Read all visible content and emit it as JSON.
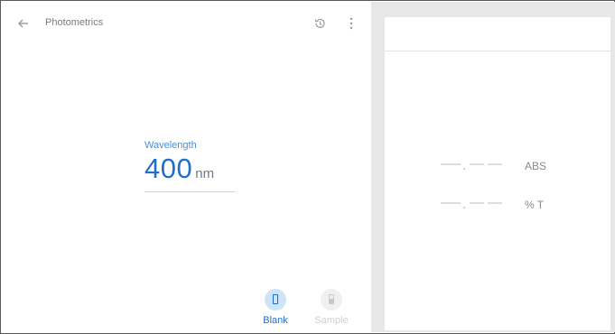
{
  "header": {
    "title": "Photometrics",
    "icons": {
      "back": "arrow-back-icon",
      "history": "history-icon",
      "more": "more-vert-icon"
    }
  },
  "wavelength": {
    "label": "Wavelength",
    "value": "400",
    "unit": "nm"
  },
  "actions": [
    {
      "label": "Blank",
      "icon": "cuvette-empty-icon",
      "enabled": true
    },
    {
      "label": "Sample",
      "icon": "cuvette-filled-icon",
      "enabled": false
    }
  ],
  "results": {
    "absorbance": {
      "value": "-.---",
      "unit": "ABS"
    },
    "transmittance": {
      "value": "-.---",
      "unit": "% T"
    }
  },
  "colors": {
    "accent": "#1e6fd0",
    "accent_light": "#cfe3fb",
    "disabled": "#cfcfcf",
    "panel_bg": "#e7e7e7"
  }
}
